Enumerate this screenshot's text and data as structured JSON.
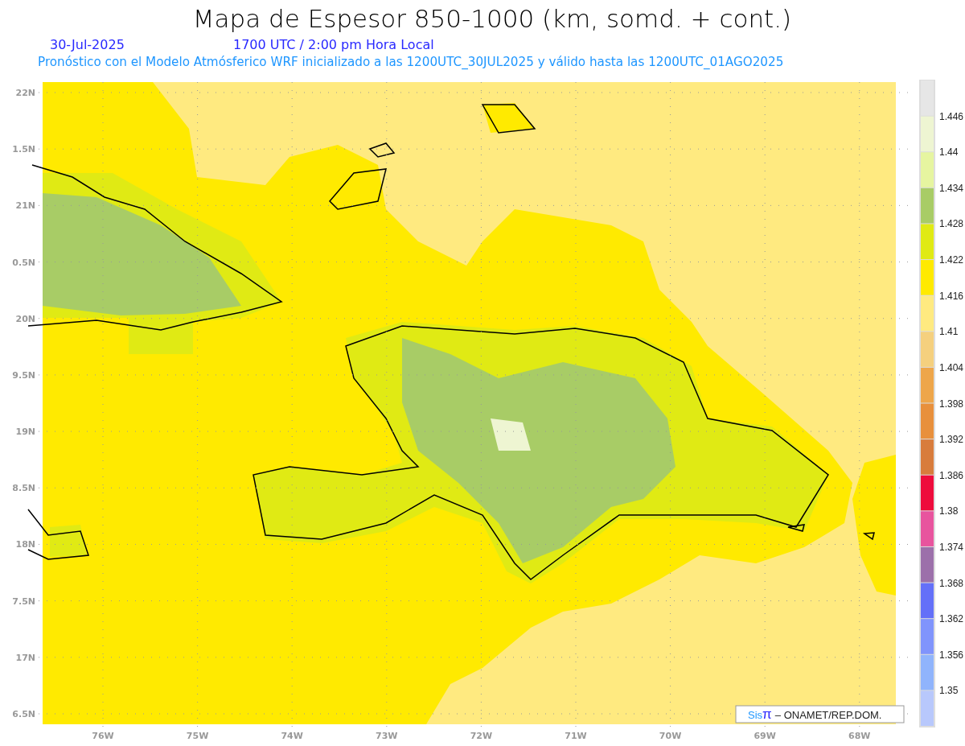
{
  "title": "Mapa de Espesor 850-1000 (km, somd. + cont.)",
  "date": "30-Jul-2025",
  "valid_time": "1700 UTC / 2:00 pm Hora Local",
  "subtitle": "Pronóstico con el Modelo Atmósferico WRF inicializado a las 1200UTC_30JUL2025 y válido hasta las 1200UTC_01AGO2025",
  "map": {
    "y_ticks": [
      "22N",
      "1.5N",
      "21N",
      "0.5N",
      "20N",
      "9.5N",
      "19N",
      "8.5N",
      "18N",
      "7.5N",
      "17N",
      "6.5N"
    ],
    "x_ticks": [
      "76W",
      "75W",
      "74W",
      "73W",
      "72W",
      "71W",
      "70W",
      "69W",
      "68W"
    ],
    "credit": {
      "brand": "Sis",
      "symbol": "π",
      "text": "– ONAMET/REP.DOM."
    }
  },
  "colorbar": {
    "segments": [
      {
        "color": "#e6e6e6"
      },
      {
        "color": "#eef5d2"
      },
      {
        "color": "#e6f5a0"
      },
      {
        "color": "#a8cc66"
      },
      {
        "color": "#e0ea14"
      },
      {
        "color": "#ffea00"
      },
      {
        "color": "#ffea80"
      },
      {
        "color": "#f5d07e"
      },
      {
        "color": "#eea64a"
      },
      {
        "color": "#e8903c"
      },
      {
        "color": "#d87c3c"
      },
      {
        "color": "#ee0c3c"
      },
      {
        "color": "#e8549e"
      },
      {
        "color": "#9c70aa"
      },
      {
        "color": "#6470f8"
      },
      {
        "color": "#8094fc"
      },
      {
        "color": "#90b4fc"
      },
      {
        "color": "#b8c8fc"
      }
    ],
    "labels": [
      "1.446",
      "1.44",
      "1.434",
      "1.428",
      "1.422",
      "1.416",
      "1.41",
      "1.404",
      "1.398",
      "1.392",
      "1.386",
      "1.38",
      "1.374",
      "1.368",
      "1.362",
      "1.356",
      "1.35"
    ]
  }
}
